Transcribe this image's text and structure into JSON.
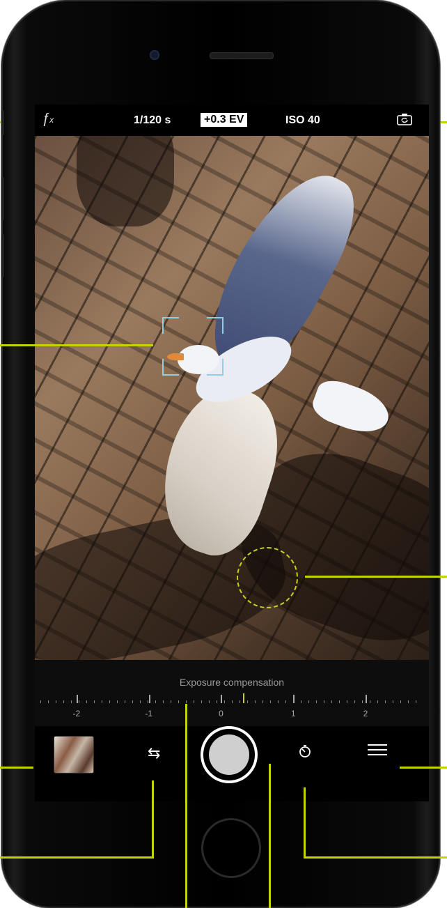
{
  "topbar": {
    "flash_icon": "flash-auto-icon",
    "shutter_speed": "1/120 s",
    "exposure_value": "+0.3 EV",
    "iso": "ISO 40",
    "flip_icon": "switch-camera-icon"
  },
  "exposure_panel": {
    "title": "Exposure compensation",
    "scale_labels": [
      "-2",
      "-1",
      "0",
      "1",
      "2"
    ],
    "current_value": 0.3,
    "range": [
      -2.5,
      2.8
    ]
  },
  "bottom_bar": {
    "thumbnail_icon": "last-photo-thumbnail",
    "swap_icon": "swap-arrows-icon",
    "swap_glyph": "⇆",
    "shutter_icon": "shutter-button",
    "timer_icon": "timer-icon",
    "menu_icon": "menu-icon"
  },
  "colors": {
    "callout": "#c3d500",
    "focus_box": "#8ecfe2",
    "exposure_indicator": "#c8d11c",
    "ev_highlight_bg": "#ffffff"
  }
}
